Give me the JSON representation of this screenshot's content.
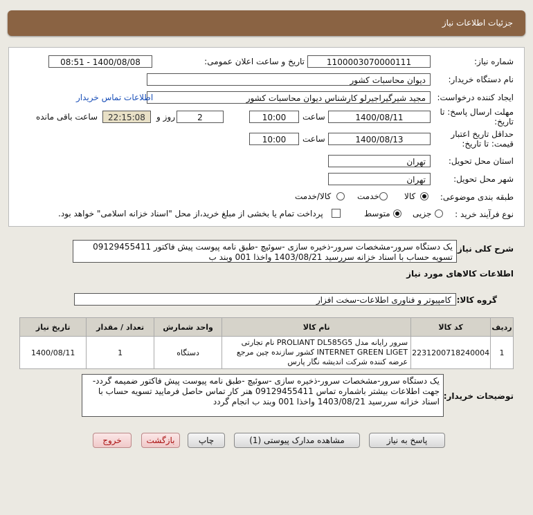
{
  "header": {
    "title": "جزئیات اطلاعات نیاز"
  },
  "fields": {
    "need_number_label": "شماره نیاز:",
    "need_number": "1100003070000111",
    "announce_label": "تاریخ و ساعت اعلان عمومی:",
    "announce_value": "1400/08/08 - 08:51",
    "buyer_org_label": "نام دستگاه خریدار:",
    "buyer_org": "دیوان محاسبات کشور",
    "creator_label": "ایجاد کننده درخواست:",
    "creator": "مجید شیرگیراجیرلو کارشناس دیوان محاسبات کشور",
    "contact_link": "اطلاعات تماس خریدار",
    "deadline_label_1": "مهلت ارسال پاسخ: تا",
    "deadline_label_2": "تاریخ:",
    "deadline_date": "1400/08/11",
    "time_label": "ساعت",
    "deadline_time": "10:00",
    "days_count": "2",
    "days_label": "روز و",
    "remain_time": "22:15:08",
    "remain_label": "ساعت باقی مانده",
    "validity_label_1": "حداقل تاریخ اعتبار",
    "validity_label_2": "قیمت: تا تاریخ:",
    "validity_date": "1400/08/13",
    "validity_time": "10:00",
    "province_label": "استان محل تحویل:",
    "province": "تهران",
    "city_label": "شهر محل تحویل:",
    "city": "تهران",
    "category_label": "طبقه بندی موضوعی:",
    "cat_goods": "کالا",
    "cat_service": "خدمت",
    "cat_both": "کالا/خدمت",
    "process_label": "نوع فرآیند خرید :",
    "proc_minor": "جزیی",
    "proc_medium": "متوسط",
    "payment_text": "پرداخت تمام یا بخشی از مبلغ خرید،از محل \"اسناد خزانه اسلامی\" خواهد بود."
  },
  "summary": {
    "label": "شرح کلی نیاز:",
    "line1": "یک دستگاه سرور-مشخصات سرور-ذخیره سازی -سوئیچ -طبق نامه پیوست پیش فاکتور 09129455411",
    "line2": "تسویه حساب با  اسناد خزانه سررسید 1403/08/21 واخذا 001 وبند ب"
  },
  "goods_info_title": "اطلاعات کالاهای مورد نیاز",
  "goods_group_label": "گروه کالا:",
  "goods_group": "کامپیوتر و فناوری اطلاعات-سخت افزار",
  "table": {
    "headers": [
      "ردیف",
      "کد کالا",
      "نام کالا",
      "واحد شمارش",
      "تعداد / مقدار",
      "تاریخ نیاز"
    ],
    "rows": [
      {
        "idx": "1",
        "code": "2231200718240004",
        "name": "سرور رایانه مدل PROLIANT DL585G5 نام تجارتی INTERNET GREEN LIGET کشور سازنده چین مرجع عرضه کننده شرکت اندیشه نگار پارس",
        "unit": "دستگاه",
        "qty": "1",
        "date": "1400/08/11"
      }
    ]
  },
  "buyer_notes": {
    "label": "توضیحات خریدار:",
    "line1": "یک دستگاه سرور-مشخصات سرور-ذخیره سازی -سوئیچ -طبق نامه پیوست پیش فاکتور ضمیمه گردد-",
    "line2": "جهت اطلاعات بیشتر باشماره تماس 09129455411 هنر کار تماس حاصل فرمایید تسویه حساب با",
    "line3": "اسناد خزانه سررسید 1403/08/21 واخذا 001 وبند ب انجام گردد"
  },
  "buttons": {
    "reply": "پاسخ به نیاز",
    "attachments": "مشاهده مدارک پیوستی (1)",
    "print": "چاپ",
    "back": "بازگشت",
    "exit": "خروج"
  }
}
